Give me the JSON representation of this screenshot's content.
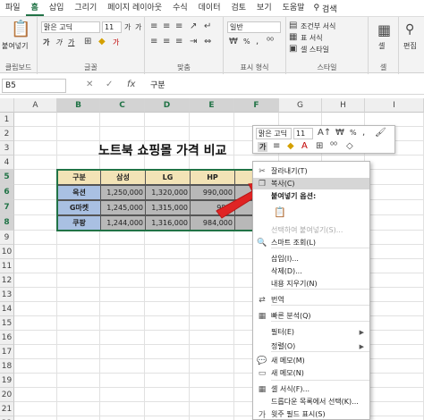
{
  "tabs": [
    "파일",
    "홈",
    "삽입",
    "그리기",
    "페이지 레이아웃",
    "수식",
    "데이터",
    "검토",
    "보기",
    "도움말"
  ],
  "active_tab": "홈",
  "search_label": "검색",
  "ribbon": {
    "clipboard": {
      "label": "클립보드",
      "paste": "붙여넣기"
    },
    "font": {
      "label": "글꼴",
      "name": "맑은 고딕",
      "size": "11",
      "bold": "가",
      "italic": "가",
      "underline": "가",
      "grow": "가",
      "shrink": "가",
      "font_color_glyph": "가"
    },
    "align": {
      "label": "맞춤"
    },
    "number": {
      "label": "표시 형식",
      "format": "일반",
      "percent": "%"
    },
    "style": {
      "label": "스타일",
      "cond": "조건부 서식",
      "table": "표 서식",
      "cell": "셀 스타일"
    },
    "cells": {
      "label": "셀",
      "name": "셀"
    },
    "edit": {
      "label": "편집"
    }
  },
  "namebox": "B5",
  "formula": "구분",
  "columns": [
    "A",
    "B",
    "C",
    "D",
    "E",
    "F",
    "G",
    "H",
    "I"
  ],
  "rows": [
    "1",
    "2",
    "3",
    "4",
    "5",
    "6",
    "7",
    "8",
    "9",
    "10",
    "11",
    "12",
    "13",
    "14",
    "15",
    "16",
    "17",
    "18",
    "19",
    "20",
    "21",
    "22"
  ],
  "sheet_title": "노트북 쇼핑몰 가격 비교",
  "table": {
    "header": [
      "구분",
      "삼성",
      "LG",
      "HP",
      "레"
    ],
    "rows": [
      [
        "옥션",
        "1,250,000",
        "1,320,000",
        "990,000",
        ""
      ],
      [
        "G마켓",
        "1,245,000",
        "1,315,000",
        "985,",
        ""
      ],
      [
        "쿠팡",
        "1,244,000",
        "1,316,000",
        "984,000",
        ""
      ]
    ]
  },
  "mini_toolbar": {
    "font": "맑은 고딕",
    "size": "11",
    "percent": "%",
    "bold": "가"
  },
  "context_menu": [
    {
      "label": "잘라내기(T)",
      "icon": "✂",
      "icon_name": "scissors-icon"
    },
    {
      "label": "복사(C)",
      "icon": "❐",
      "icon_name": "copy-icon",
      "highlight": true
    },
    {
      "label": "붙여넣기 옵션:",
      "icon": "",
      "icon_name": "paste-options-icon",
      "header": true
    },
    {
      "label": "",
      "icon": "📋",
      "icon_name": "clipboard-icon",
      "disabled": true
    },
    {
      "label": "선택하여 붙여넣기(S)...",
      "icon": "",
      "icon_name": "paste-special-icon",
      "disabled": true
    },
    {
      "label": "스마트 조회(L)",
      "icon": "🔍",
      "icon_name": "search-icon"
    },
    {
      "label": "삽입(I)...",
      "icon": "",
      "icon_name": "insert-icon"
    },
    {
      "label": "삭제(D)...",
      "icon": "",
      "icon_name": "delete-icon"
    },
    {
      "label": "내용 지우기(N)",
      "icon": "",
      "icon_name": "clear-icon"
    },
    {
      "label": "번역",
      "icon": "⇄",
      "icon_name": "translate-icon"
    },
    {
      "label": "빠른 분석(Q)",
      "icon": "▦",
      "icon_name": "quick-analysis-icon"
    },
    {
      "label": "필터(E)",
      "icon": "",
      "icon_name": "filter-icon",
      "submenu": true
    },
    {
      "label": "정렬(O)",
      "icon": "",
      "icon_name": "sort-icon",
      "submenu": true
    },
    {
      "label": "새 메모(M)",
      "icon": "💬",
      "icon_name": "new-comment-icon"
    },
    {
      "label": "새 메모(N)",
      "icon": "▭",
      "icon_name": "new-note-icon"
    },
    {
      "label": "셀 서식(F)...",
      "icon": "▦",
      "icon_name": "format-cells-icon"
    },
    {
      "label": "드롭다운 목록에서 선택(K)...",
      "icon": "",
      "icon_name": "dropdown-pick-icon"
    },
    {
      "label": "윗주 필드 표시(S)",
      "icon": "가",
      "icon_name": "phonetic-icon"
    }
  ]
}
